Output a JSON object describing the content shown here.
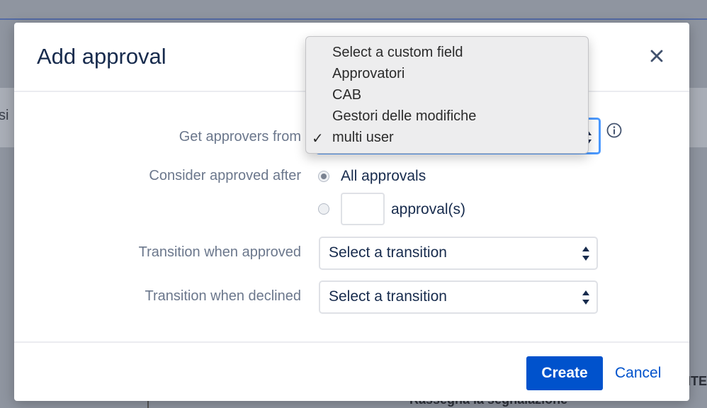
{
  "modal": {
    "title": "Add approval"
  },
  "form": {
    "approvers_label": "Get approvers from",
    "consider_label": "Consider approved after",
    "all_approvals_label": "All approvals",
    "count_suffix_label": "approval(s)",
    "count_value": "",
    "approved_label": "Transition when approved",
    "approved_select_value": "Select a transition",
    "declined_label": "Transition when declined",
    "declined_select_value": "Select a transition"
  },
  "dropdown": {
    "options": [
      "Select a custom field",
      "Approvatori",
      "CAB",
      "Gestori delle modifiche",
      "multi user"
    ],
    "selected": "multi user"
  },
  "footer": {
    "create_label": "Create",
    "cancel_label": "Cancel"
  },
  "background": {
    "side_text": "si",
    "bottom_text": "Rassegna la segnalazione",
    "right_text": "NTE"
  },
  "colors": {
    "primary": "#0052cc",
    "focus": "#4c9aff",
    "text": "#172b4d",
    "label": "#6b778c"
  }
}
